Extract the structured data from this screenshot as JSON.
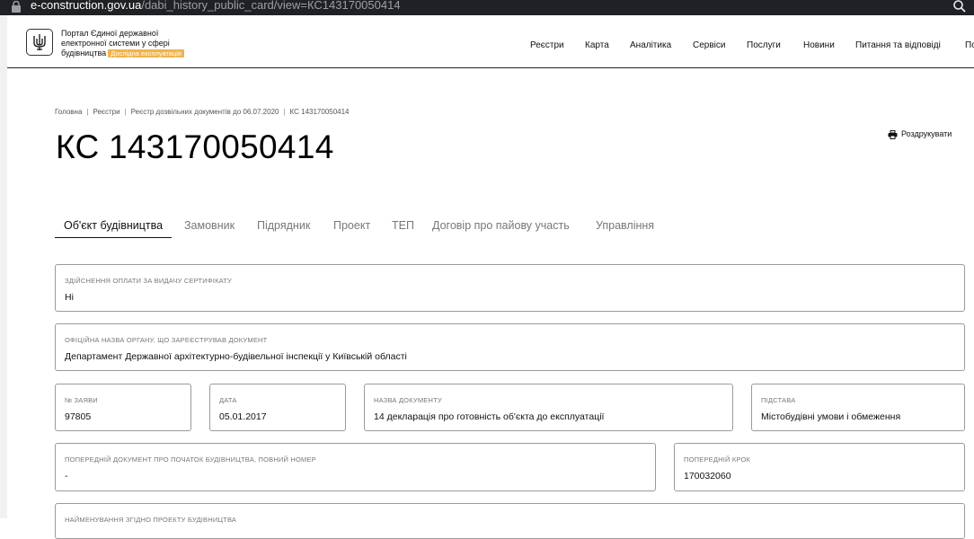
{
  "browser": {
    "url_domain": "e-construction.gov.ua",
    "url_path": "/dabi_history_public_card/view=КС143170050414"
  },
  "header": {
    "portal_line1": "Портал Єдиної державної",
    "portal_line2": "електронної системи у сфері",
    "portal_line3": "будівництва",
    "badge": "Дослідна експлуатація",
    "nav": [
      "Реєстри",
      "Карта",
      "Аналітика",
      "Сервіси",
      "Послуги",
      "Новини",
      "Питання та відповіді",
      "По"
    ]
  },
  "breadcrumb": [
    "Головна",
    "Реєстри",
    "Реєстр дозвільних документів до 06.07.2020",
    "КС 143170050414"
  ],
  "page": {
    "title": "КС 143170050414",
    "print_label": "Роздрукувати"
  },
  "tabs": [
    "Об'єкт будівництва",
    "Замовник",
    "Підрядник",
    "Проект",
    "ТЕП",
    "Договір про пайову участь",
    "Управління"
  ],
  "fields": {
    "payment": {
      "label": "Здійснення оплати за видачу сертифікату",
      "value": "Ні"
    },
    "authority": {
      "label": "Офіційна назва органу, що зареєстрував документ",
      "value": "Департамент Державної архітектурно-будівельної інспекції у Київській області"
    },
    "app_no": {
      "label": "№ заяви",
      "value": "97805"
    },
    "date": {
      "label": "Дата",
      "value": "05.01.2017"
    },
    "doc_name": {
      "label": "Назва документу",
      "value": "14 декларація про готовність об'єкта до експлуатації"
    },
    "basis": {
      "label": "Підстава",
      "value": "Містобудівні умови і обмеження"
    },
    "prev_doc": {
      "label": "Попередній документ про початок будівництва, повний номер",
      "value": "-"
    },
    "prev_step": {
      "label": "Попередній крок",
      "value": "170032060"
    },
    "project_name": {
      "label": "Найменування згідно проекту будівництва"
    }
  }
}
